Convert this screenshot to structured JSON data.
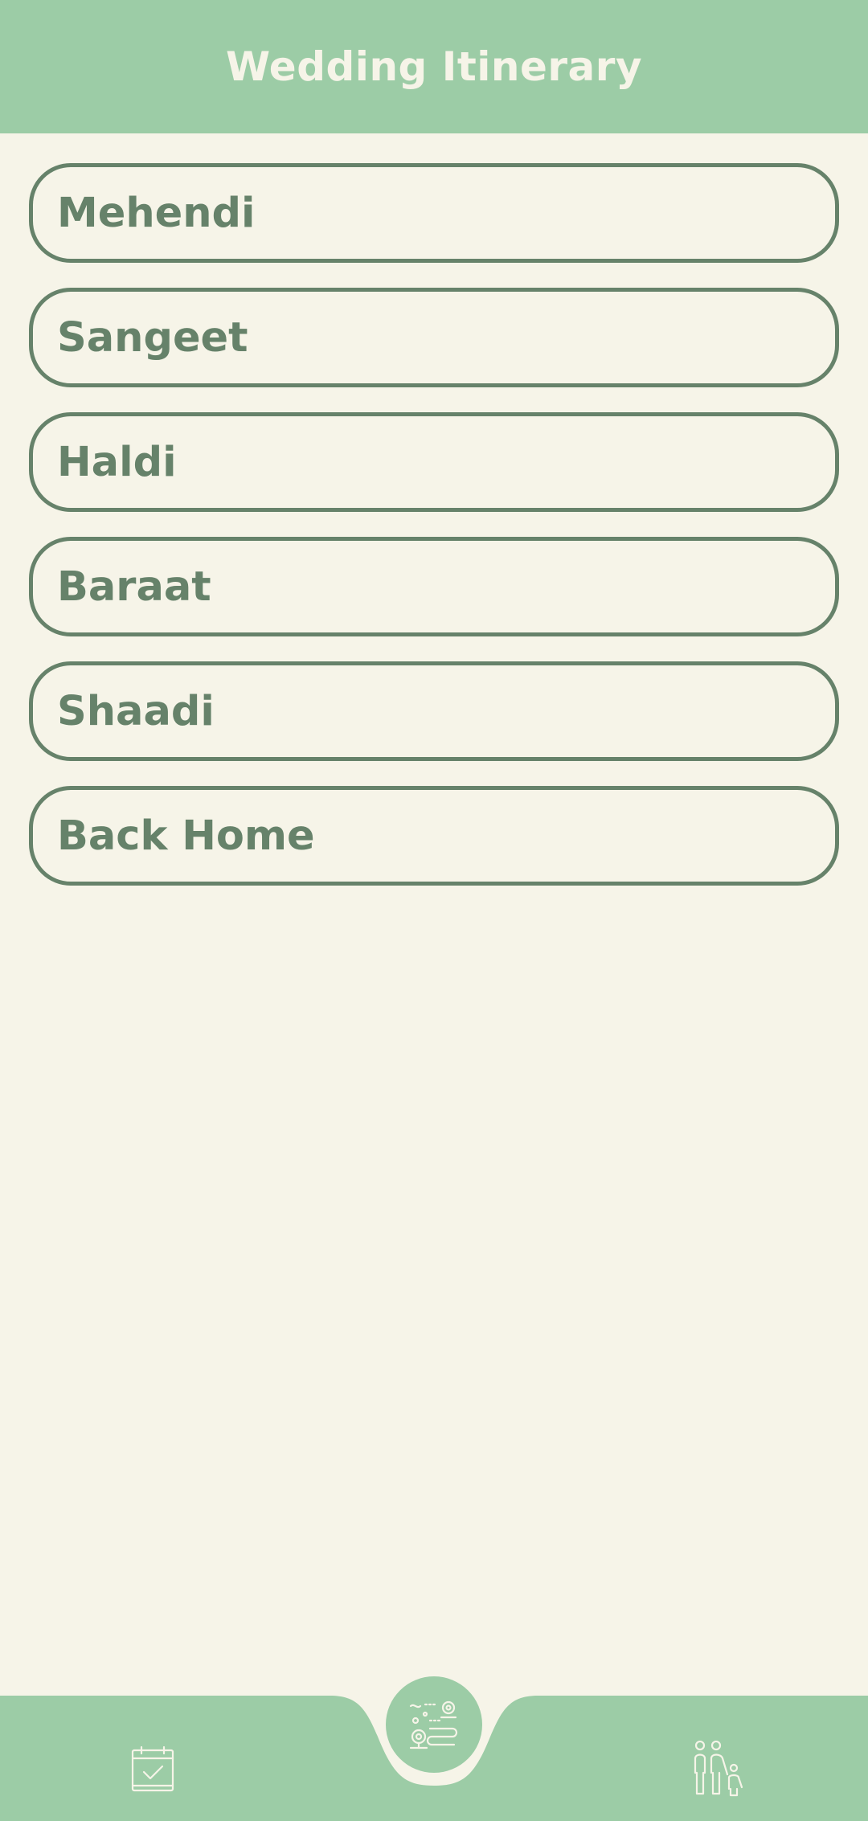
{
  "header": {
    "title": "Wedding Itinerary"
  },
  "events": [
    {
      "label": "Mehendi"
    },
    {
      "label": "Sangeet"
    },
    {
      "label": "Haldi"
    },
    {
      "label": "Baraat"
    },
    {
      "label": "Shaadi"
    },
    {
      "label": "Back Home"
    }
  ],
  "bottom_nav": {
    "items": [
      {
        "icon": "calendar-check-icon"
      },
      {
        "icon": "itinerary-route-icon",
        "active": true
      },
      {
        "icon": "family-icon"
      }
    ]
  },
  "colors": {
    "primary": "#9CCCA6",
    "accent": "#66826A",
    "background": "#F6F4E8",
    "on_primary": "#F6F4E8"
  }
}
